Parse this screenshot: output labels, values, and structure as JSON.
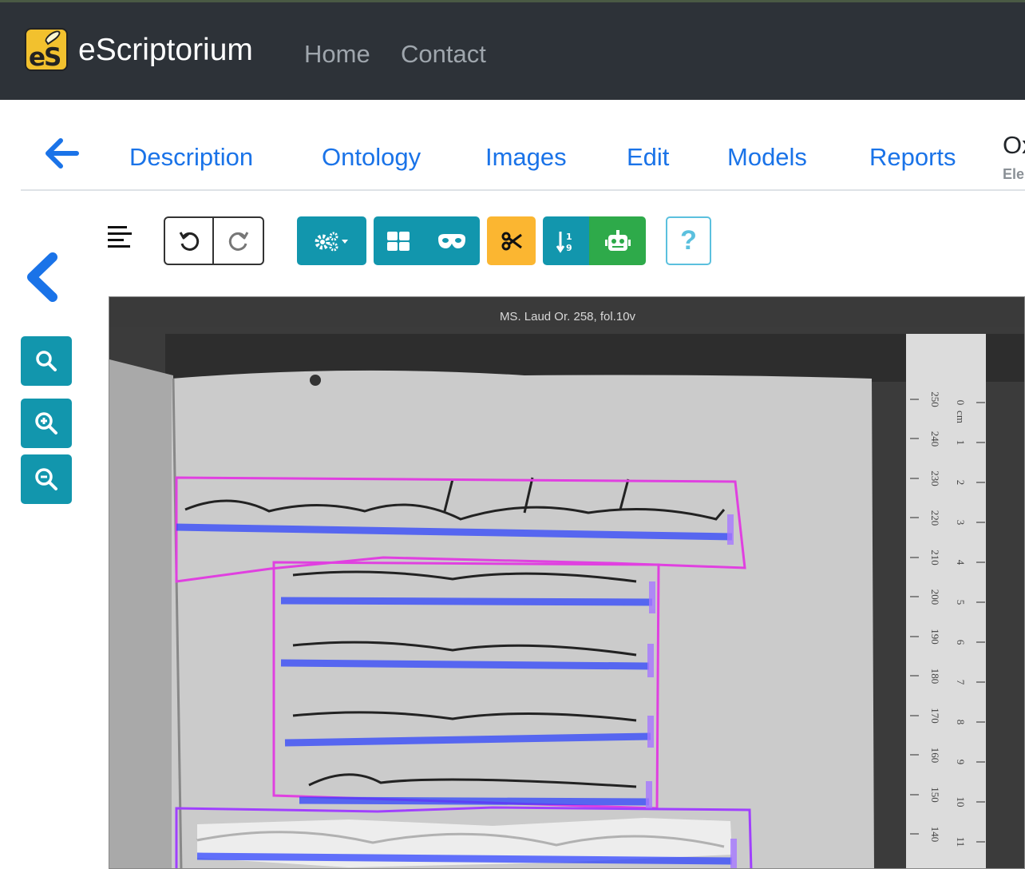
{
  "navbar": {
    "brand": "eScriptorium",
    "logo_text": "eS",
    "links": [
      "Home",
      "Contact"
    ]
  },
  "tabs": {
    "items": [
      "Description",
      "Ontology",
      "Images",
      "Edit",
      "Models",
      "Reports"
    ],
    "doc_title": "Ox",
    "doc_subtitle": "Ele"
  },
  "toolbar": {
    "icons": [
      "list-icon",
      "undo-icon",
      "redo-icon",
      "settings-icon",
      "grid-icon",
      "mask-icon",
      "scissors-icon",
      "sort-icon",
      "robot-icon",
      "help-icon"
    ],
    "help_label": "?",
    "colors": {
      "teal": "#1296ad",
      "warning": "#fbb631",
      "success": "#2eaa4a"
    }
  },
  "left_panel": {
    "icons": [
      "chevron-left-icon",
      "search-icon",
      "zoom-in-icon",
      "zoom-out-icon"
    ]
  },
  "viewer": {
    "caption": "MS. Laud Or. 258, fol.10v",
    "ruler_mm": [
      "250",
      "240",
      "230",
      "220",
      "210",
      "200",
      "190",
      "180",
      "170",
      "160",
      "150",
      "140"
    ],
    "ruler_cm": [
      "0",
      "1",
      "2",
      "3",
      "4",
      "5",
      "6",
      "7",
      "8",
      "9",
      "10",
      "11"
    ],
    "ruler_unit": "cm",
    "colors": {
      "region": "#e040e0",
      "region2": "#a040ff",
      "baseline": "#2a40ff"
    }
  }
}
